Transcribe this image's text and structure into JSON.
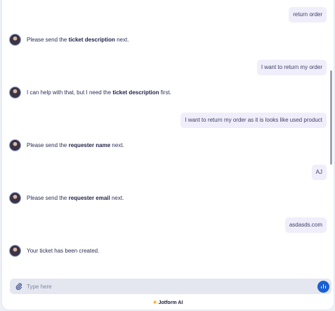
{
  "messages": [
    {
      "role": "user",
      "text": "return order"
    },
    {
      "role": "bot",
      "before": "Please send the ",
      "bold": "ticket description",
      "after": " next."
    },
    {
      "role": "user",
      "text": "I want to return my order"
    },
    {
      "role": "bot",
      "before": "I can help with that, but I need the ",
      "bold": "ticket description",
      "after": " first."
    },
    {
      "role": "user",
      "text": "I want to return my order as it is looks like used product"
    },
    {
      "role": "bot",
      "before": "Please send the ",
      "bold": "requester name",
      "after": " next."
    },
    {
      "role": "user",
      "text": "AJ"
    },
    {
      "role": "bot",
      "before": "Please send the ",
      "bold": "requester email",
      "after": " next."
    },
    {
      "role": "user",
      "text": "asdasds.com"
    },
    {
      "role": "bot",
      "before": "Your ticket has been created.",
      "bold": "",
      "after": ""
    }
  ],
  "composer": {
    "placeholder": "Type here"
  },
  "footer": {
    "brand": "Jotform AI"
  },
  "icons": {
    "attach": "paperclip-icon",
    "voice": "microphone-icon",
    "brand": "sparkle-icon"
  }
}
